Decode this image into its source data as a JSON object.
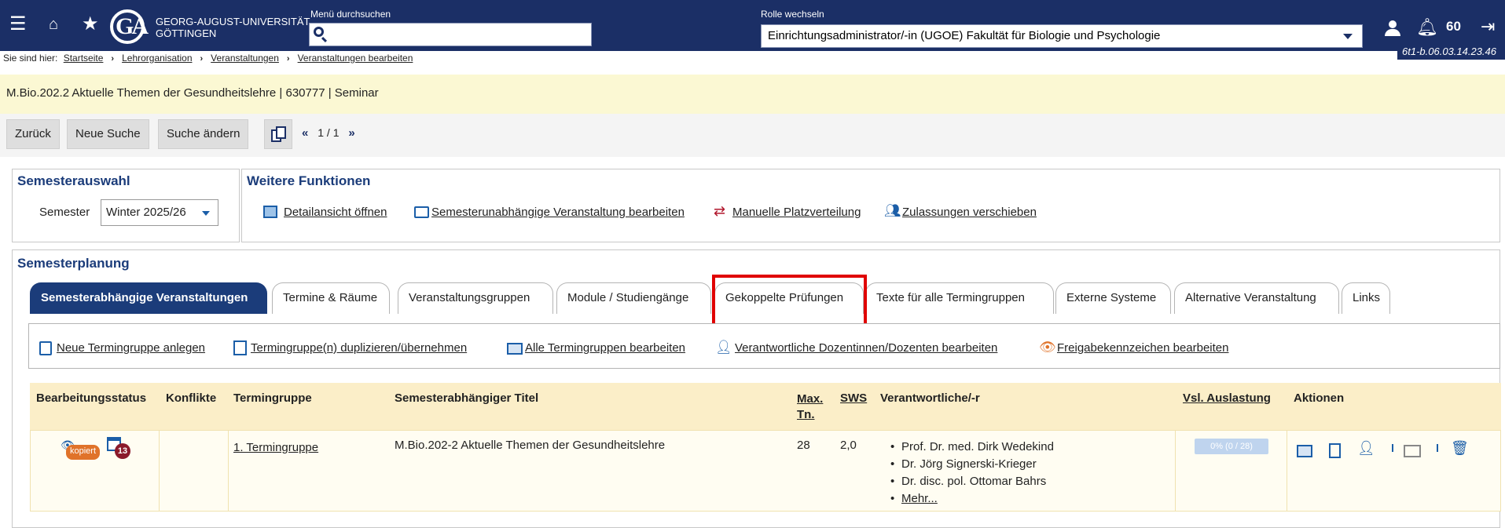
{
  "header": {
    "university_line1": "GEORG-AUGUST-UNIVERSITÄT",
    "university_line2": "GÖTTINGEN",
    "logo_text": "GA",
    "menu_search_label": "Menü durchsuchen",
    "menu_search_value": "",
    "role_label": "Rolle wechseln",
    "role_value": "Einrichtungsadministrator/-in (UGOE) Fakultät für Biologie und Psychologie",
    "counter": "60",
    "version": "6t1-b.06.03.14.23.46",
    "icons": [
      "menu-icon",
      "home-icon",
      "star-icon",
      "user-icon",
      "bell-icon",
      "logout-icon"
    ]
  },
  "breadcrumb": {
    "prefix": "Sie sind hier:",
    "items": [
      "Startseite",
      "Lehrorganisation",
      "Veranstaltungen",
      "Veranstaltungen bearbeiten"
    ]
  },
  "title_bar": "M.Bio.202.2 Aktuelle Themen der Gesundheitslehre | 630777 | Seminar",
  "toolbar": {
    "back": "Zurück",
    "new_search": "Neue Suche",
    "change_search": "Suche ändern",
    "pager": "1 / 1"
  },
  "semesterauswahl": {
    "title": "Semesterauswahl",
    "label": "Semester",
    "value": "Winter 2025/26"
  },
  "weitere_funktionen": {
    "title": "Weitere Funktionen",
    "links": [
      "Detailansicht öffnen",
      "Semesterunabhängige Veranstaltung bearbeiten",
      "Manuelle Platzverteilung",
      "Zulassungen verschieben"
    ]
  },
  "semesterplanung": {
    "title": "Semesterplanung",
    "tabs": [
      "Semesterabhängige Veranstaltungen",
      "Termine & Räume",
      "Veranstaltungsgruppen",
      "Module / Studiengänge",
      "Gekoppelte Prüfungen",
      "Texte für alle Termingruppen",
      "Externe Systeme",
      "Alternative Veranstaltung",
      "Links"
    ],
    "active_tab": "Semesterabhängige Veranstaltungen",
    "highlighted_tab": "Gekoppelte Prüfungen",
    "actions": [
      "Neue Termingruppe anlegen",
      "Termingruppe(n) duplizieren/übernehmen",
      "Alle Termingruppen bearbeiten",
      "Verantwortliche Dozentinnen/Dozenten bearbeiten",
      "Freigabekennzeichen bearbeiten"
    ]
  },
  "table": {
    "headers": {
      "status": "Bearbeitungsstatus",
      "konflikte": "Konflikte",
      "termingruppe": "Termingruppe",
      "titel": "Semesterabhängiger Titel",
      "max_tn_1": "Max.",
      "max_tn_2": "Tn.",
      "sws": "SWS",
      "verantwortliche": "Verantwortliche/-r",
      "auslastung": "Vsl. Auslastung",
      "aktionen": "Aktionen"
    },
    "rows": [
      {
        "status_badge": "kopiert",
        "status_count": "13",
        "konflikte": "",
        "termingruppe": "1. Termingruppe",
        "titel": "M.Bio.202-2 Aktuelle Themen der Gesundheitslehre",
        "max_tn": "28",
        "sws": "2,0",
        "verantwortliche": [
          "Prof. Dr. med. Dirk Wedekind",
          "Dr. Jörg Signerski-Krieger",
          "Dr. disc. pol. Ottomar Bahrs"
        ],
        "more": "Mehr...",
        "auslastung": "0% (0 / 28)"
      }
    ]
  },
  "colors": {
    "header_bg": "#1b2f66",
    "title_bar_bg": "#fbf8d3",
    "active_tab": "#1b3c7a",
    "highlight": "#e00000",
    "table_head": "#fbeec8"
  }
}
